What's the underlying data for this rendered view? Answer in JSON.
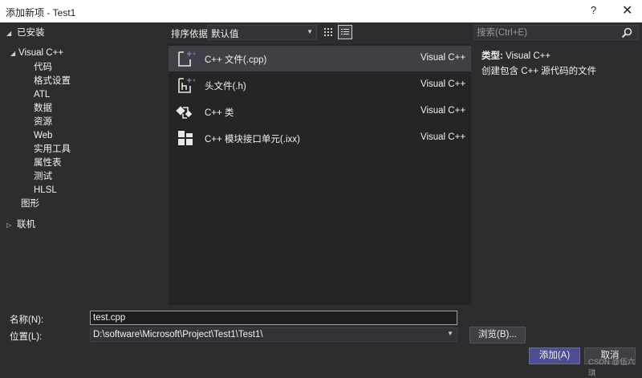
{
  "window": {
    "title": "添加新项 - Test1",
    "help_label": "?",
    "close_label": "✕"
  },
  "tree": {
    "installed": "已安装",
    "visual_cpp": "Visual C++",
    "children": [
      "代码",
      "格式设置",
      "ATL",
      "数据",
      "资源",
      "Web",
      "实用工具",
      "属性表",
      "测试",
      "HLSL"
    ],
    "graphics": "图形",
    "online": "联机"
  },
  "sort": {
    "label": "排序依据:",
    "value": "默认值"
  },
  "search": {
    "placeholder": "搜索(Ctrl+E)"
  },
  "templates": [
    {
      "name": "C++ 文件(.cpp)",
      "lang": "Visual C++",
      "icon": "cpp-file-icon"
    },
    {
      "name": "头文件(.h)",
      "lang": "Visual C++",
      "icon": "header-file-icon"
    },
    {
      "name": "C++ 类",
      "lang": "Visual C++",
      "icon": "class-icon"
    },
    {
      "name": "C++ 模块接口单元(.ixx)",
      "lang": "Visual C++",
      "icon": "module-icon"
    }
  ],
  "description": {
    "type_label": "类型:",
    "type_value": "Visual C++",
    "text": "创建包含 C++ 源代码的文件"
  },
  "form": {
    "name_label": "名称(N):",
    "name_value": "test.cpp",
    "location_label": "位置(L):",
    "location_value": "D:\\software\\Microsoft\\Project\\Test1\\Test1\\",
    "browse_label": "浏览(B)...",
    "add_label": "添加(A)",
    "cancel_label": "取消"
  },
  "watermark": "CSDN @伍六琪",
  "colors": {
    "background": "#2d2d30",
    "panel": "#252526",
    "selection": "#3f3f46",
    "accent": "#b180d7",
    "primary_button": "#4d4d90"
  }
}
